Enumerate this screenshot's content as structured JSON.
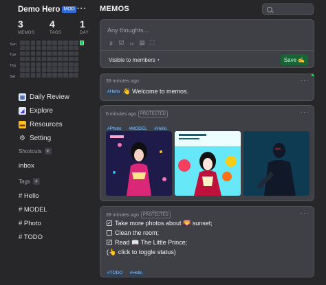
{
  "user": {
    "name": "Demo Hero",
    "badge": "MOD",
    "more": "···"
  },
  "stats": [
    {
      "value": "3",
      "label": "MEMOS"
    },
    {
      "value": "4",
      "label": "TAGS"
    },
    {
      "value": "1",
      "label": "DAY"
    }
  ],
  "heatmap": {
    "days": [
      "Sun",
      "Tue",
      "Thu",
      "Sat"
    ],
    "active_color": "#22c55e"
  },
  "nav": [
    {
      "label": "Daily Review",
      "icon": "calendar-icon"
    },
    {
      "label": "Explore",
      "icon": "explore-icon"
    },
    {
      "label": "Resources",
      "icon": "folder-icon"
    },
    {
      "label": "Setting",
      "icon": "gear-icon"
    }
  ],
  "shortcuts": {
    "title": "Shortcuts",
    "add": "+",
    "items": [
      "inbox"
    ]
  },
  "tags": {
    "title": "Tags",
    "add": "+",
    "items": [
      "# Hello",
      "# MODEL",
      "# Photo",
      "# TODO"
    ]
  },
  "main": {
    "title": "MEMOS",
    "search_placeholder": "",
    "editor": {
      "placeholder": "Any thoughts...",
      "visibility": "Visible to members",
      "save": "Save ✍"
    }
  },
  "memos": [
    {
      "time": "39 minutes ago",
      "tag": "#Hello",
      "text": "👋 Welcome to memos.",
      "more": "···"
    },
    {
      "time": "6 minutes ago",
      "badge": "PROTECTED",
      "tags": [
        "#Photo",
        "#MODEL",
        "#Hello"
      ],
      "more": "···"
    },
    {
      "time": "39 minutes ago",
      "badge": "PROTECTED",
      "more": "···",
      "lines": [
        {
          "checked": true,
          "text": "Take more photos about 🌄 sunset;"
        },
        {
          "checked": false,
          "text": "Clean the room;"
        },
        {
          "checked": true,
          "text": "Read 📖 The Little Prince;"
        }
      ],
      "note": "(👆 click to toggle status)",
      "tags": [
        "#TODO",
        "#Hello"
      ]
    }
  ],
  "colors": {
    "accent": "#2f6bd9",
    "save": "#166534",
    "tag": "#93c5fd"
  }
}
